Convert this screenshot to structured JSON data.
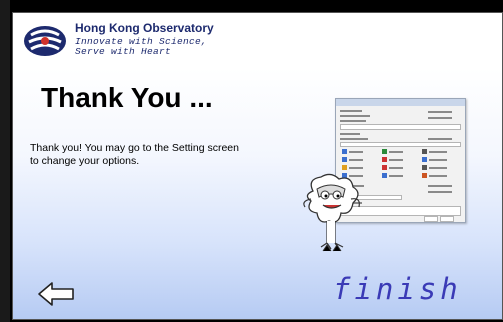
{
  "header": {
    "org_name": "Hong Kong Observatory",
    "slogan": "Innovate with Science,\nServe with Heart"
  },
  "main": {
    "title": "Thank You ...",
    "message": "Thank you!  You may go to the Setting screen to change your options."
  },
  "nav": {
    "finish_label": "finish"
  },
  "colors": {
    "brand_navy": "#1d2a6e",
    "finish_blue": "#3a3ab6",
    "gradient_bottom": "#b6cbf3"
  },
  "icons": {
    "logo": "hko-logo-icon",
    "back": "back-arrow-icon",
    "mascot": "mascot-icon"
  }
}
